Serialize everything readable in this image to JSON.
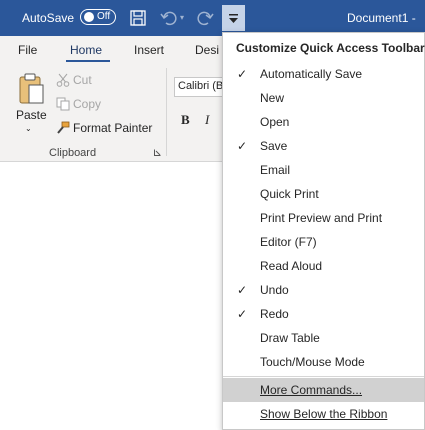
{
  "titlebar": {
    "autosave_label": "AutoSave",
    "autosave_state": "Off",
    "document_title": "Document1",
    "separator": "-"
  },
  "tabs": [
    {
      "label": "File"
    },
    {
      "label": "Home",
      "active": true
    },
    {
      "label": "Insert"
    },
    {
      "label": "Desi"
    }
  ],
  "clipboard": {
    "paste_label": "Paste",
    "cut_label": "Cut",
    "copy_label": "Copy",
    "format_painter_label": "Format Painter",
    "group_label": "Clipboard"
  },
  "font": {
    "font_name": "Calibri (B",
    "bold_label": "B",
    "italic_label": "I"
  },
  "menu": {
    "header": "Customize Quick Access Toolbar",
    "items": [
      {
        "label": "Automatically Save",
        "checked": true
      },
      {
        "label": "New",
        "checked": false
      },
      {
        "label": "Open",
        "checked": false
      },
      {
        "label": "Save",
        "checked": true
      },
      {
        "label": "Email",
        "checked": false
      },
      {
        "label": "Quick Print",
        "checked": false
      },
      {
        "label": "Print Preview and Print",
        "checked": false
      },
      {
        "label": "Editor (F7)",
        "checked": false
      },
      {
        "label": "Read Aloud",
        "checked": false
      },
      {
        "label": "Undo",
        "checked": true
      },
      {
        "label": "Redo",
        "checked": true
      },
      {
        "label": "Draw Table",
        "checked": false
      },
      {
        "label": "Touch/Mouse Mode",
        "checked": false
      }
    ],
    "more_commands_label": "More Commands...",
    "show_below_label": "Show Below the Ribbon",
    "check_glyph": "✓"
  },
  "colors": {
    "title_bar": "#2b579a",
    "ribbon_bg": "#f3f2f1",
    "menu_highlight": "#d1d1d1"
  },
  "icons": [
    "save-icon",
    "undo-icon",
    "redo-icon",
    "customize-qat-icon",
    "paste-icon",
    "cut-icon",
    "copy-icon",
    "format-painter-icon",
    "dialog-launcher-icon"
  ]
}
